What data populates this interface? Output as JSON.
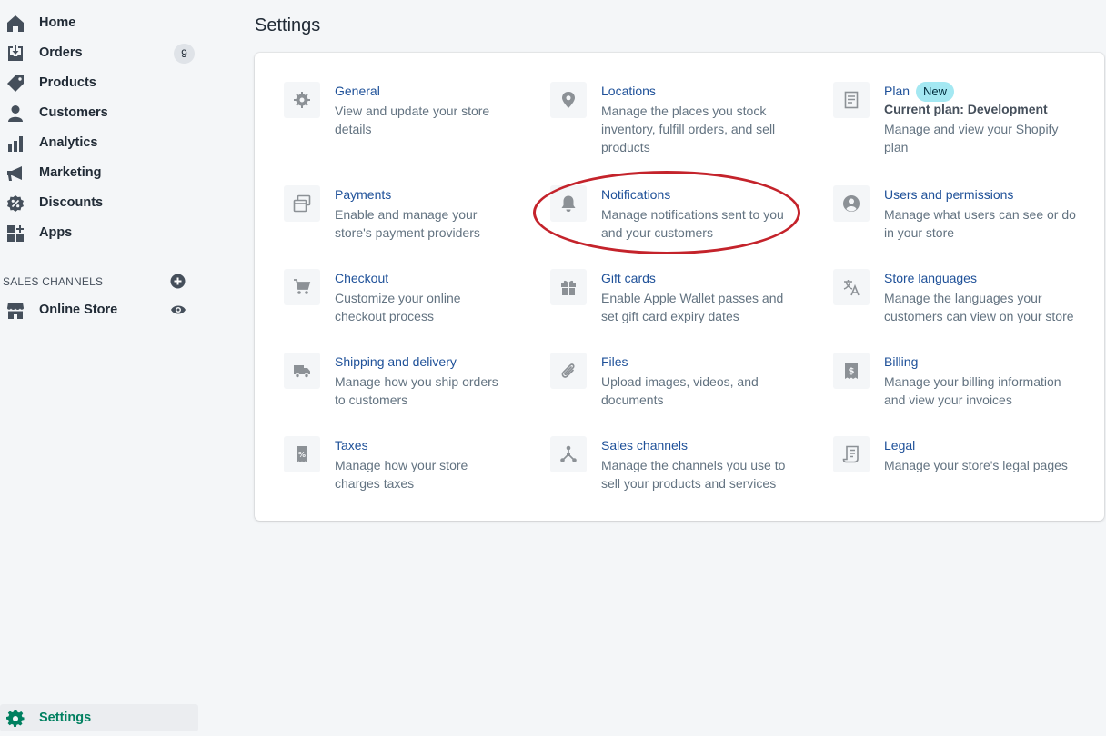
{
  "sidebar": {
    "items": [
      {
        "label": "Home"
      },
      {
        "label": "Orders",
        "badge": "9"
      },
      {
        "label": "Products"
      },
      {
        "label": "Customers"
      },
      {
        "label": "Analytics"
      },
      {
        "label": "Marketing"
      },
      {
        "label": "Discounts"
      },
      {
        "label": "Apps"
      }
    ],
    "sales_channels_heading": "SALES CHANNELS",
    "online_store_label": "Online Store",
    "settings_label": "Settings"
  },
  "page": {
    "title": "Settings"
  },
  "tiles": [
    {
      "title": "General",
      "desc": "View and update your store details"
    },
    {
      "title": "Locations",
      "desc": "Manage the places you stock inventory, fulfill orders, and sell products"
    },
    {
      "title": "Plan",
      "badge": "New",
      "subtitle": "Current plan: Development",
      "desc": "Manage and view your Shopify plan"
    },
    {
      "title": "Payments",
      "desc": "Enable and manage your store's payment providers"
    },
    {
      "title": "Notifications",
      "desc": "Manage notifications sent to you and your customers"
    },
    {
      "title": "Users and permissions",
      "desc": "Manage what users can see or do in your store"
    },
    {
      "title": "Checkout",
      "desc": "Customize your online checkout process"
    },
    {
      "title": "Gift cards",
      "desc": "Enable Apple Wallet passes and set gift card expiry dates"
    },
    {
      "title": "Store languages",
      "desc": "Manage the languages your customers can view on your store"
    },
    {
      "title": "Shipping and delivery",
      "desc": "Manage how you ship orders to customers"
    },
    {
      "title": "Files",
      "desc": "Upload images, videos, and documents"
    },
    {
      "title": "Billing",
      "desc": "Manage your billing information and view your invoices"
    },
    {
      "title": "Taxes",
      "desc": "Manage how your store charges taxes"
    },
    {
      "title": "Sales channels",
      "desc": "Manage the channels you use to sell your products and services"
    },
    {
      "title": "Legal",
      "desc": "Manage your store's legal pages"
    }
  ],
  "colors": {
    "accent": "#008060",
    "link": "#1f5199",
    "annotation": "#c4232b",
    "badge_new": "#a4e8f2"
  }
}
